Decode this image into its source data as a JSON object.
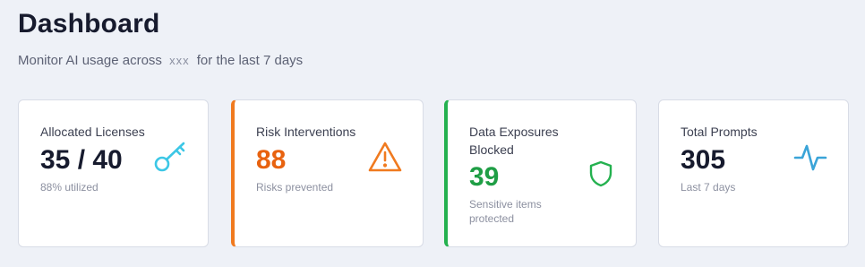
{
  "header": {
    "title": "Dashboard",
    "subtitle_prefix": "Monitor AI usage across",
    "org": "xxx",
    "subtitle_suffix": "for the last 7 days"
  },
  "cards": [
    {
      "label": "Allocated Licenses",
      "value": "35 / 40",
      "note": "88% utilized",
      "icon": "key-icon",
      "value_color": "#171b2e",
      "icon_color": "#3cc7e6"
    },
    {
      "label": "Risk Interventions",
      "value": "88",
      "note": "Risks prevented",
      "icon": "warning-icon",
      "value_color": "#e8620f",
      "icon_color": "#f07a1f",
      "accent": "#f07a1f"
    },
    {
      "label": "Data Exposures Blocked",
      "value": "39",
      "note": "Sensitive items protected",
      "icon": "shield-icon",
      "value_color": "#1f9e45",
      "icon_color": "#24b14f",
      "accent": "#24b14f"
    },
    {
      "label": "Total Prompts",
      "value": "305",
      "note": "Last 7 days",
      "icon": "activity-icon",
      "value_color": "#171b2e",
      "icon_color": "#3aa4d8"
    }
  ]
}
